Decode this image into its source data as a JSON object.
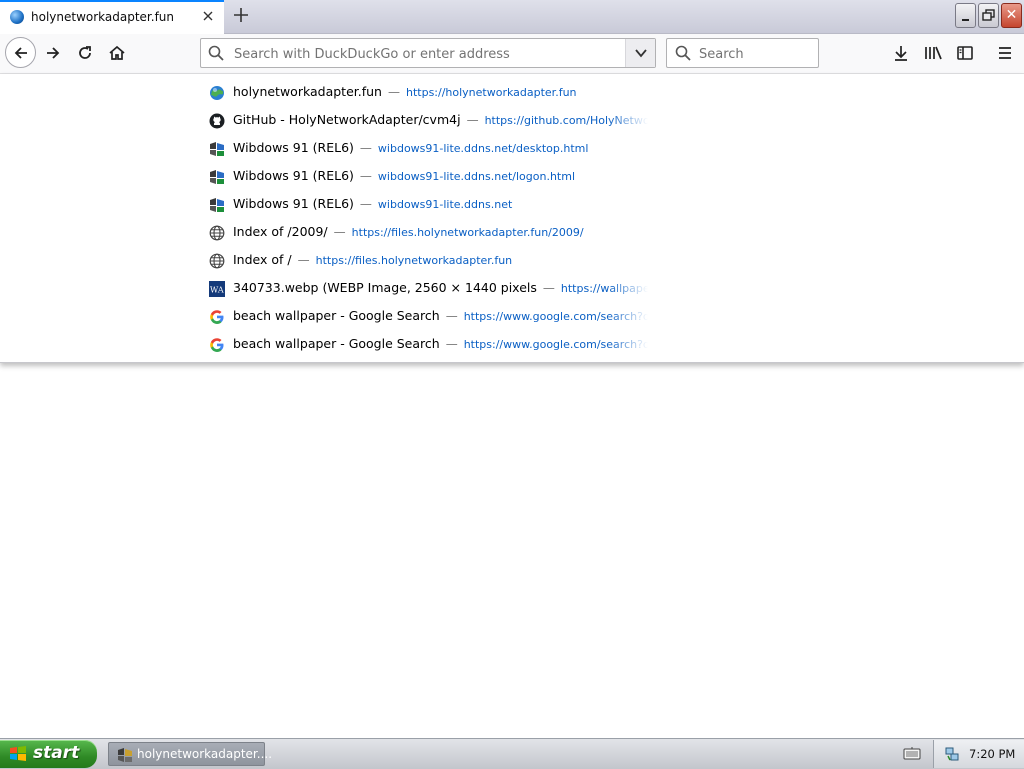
{
  "tab": {
    "title": "holynetworkadapter.fun",
    "new_tab": "+"
  },
  "window": {
    "close_glyph": "✕"
  },
  "urlbar": {
    "placeholder": "Search with DuckDuckGo or enter address"
  },
  "searchbar": {
    "placeholder": "Search"
  },
  "dropdown": {
    "items": [
      {
        "icon": "globe-favicon-icon",
        "title": "holynetworkadapter.fun",
        "url": "https://holynetworkadapter.fun"
      },
      {
        "icon": "github-icon",
        "title": "GitHub - HolyNetworkAdapter/cvm4j",
        "url": "https://github.com/HolyNetworkAdapte"
      },
      {
        "icon": "wibdows-icon",
        "title": "Wibdows 91 (REL6)",
        "url": "wibdows91-lite.ddns.net/desktop.html"
      },
      {
        "icon": "wibdows-icon",
        "title": "Wibdows 91 (REL6)",
        "url": "wibdows91-lite.ddns.net/logon.html"
      },
      {
        "icon": "wibdows-icon",
        "title": "Wibdows 91 (REL6)",
        "url": "wibdows91-lite.ddns.net"
      },
      {
        "icon": "globe-outline-icon",
        "title": "Index of /2009/",
        "url": "https://files.holynetworkadapter.fun/2009/"
      },
      {
        "icon": "globe-outline-icon",
        "title": "Index of /",
        "url": "https://files.holynetworkadapter.fun"
      },
      {
        "icon": "wa-icon",
        "title": "340733.webp (WEBP Image, 2560 × 1440 pixels",
        "url": "https://wallpaperaccess"
      },
      {
        "icon": "google-icon",
        "title": "beach wallpaper - Google Search",
        "url": "https://www.google.com/search?q=beach"
      },
      {
        "icon": "google-icon",
        "title": "beach wallpaper - Google Search",
        "url": "https://www.google.com/search?q=beach"
      }
    ],
    "separator": "—"
  },
  "taskbar": {
    "start_label": "start",
    "task_label": "holynetworkadapter....",
    "clock": "7:20 PM"
  }
}
